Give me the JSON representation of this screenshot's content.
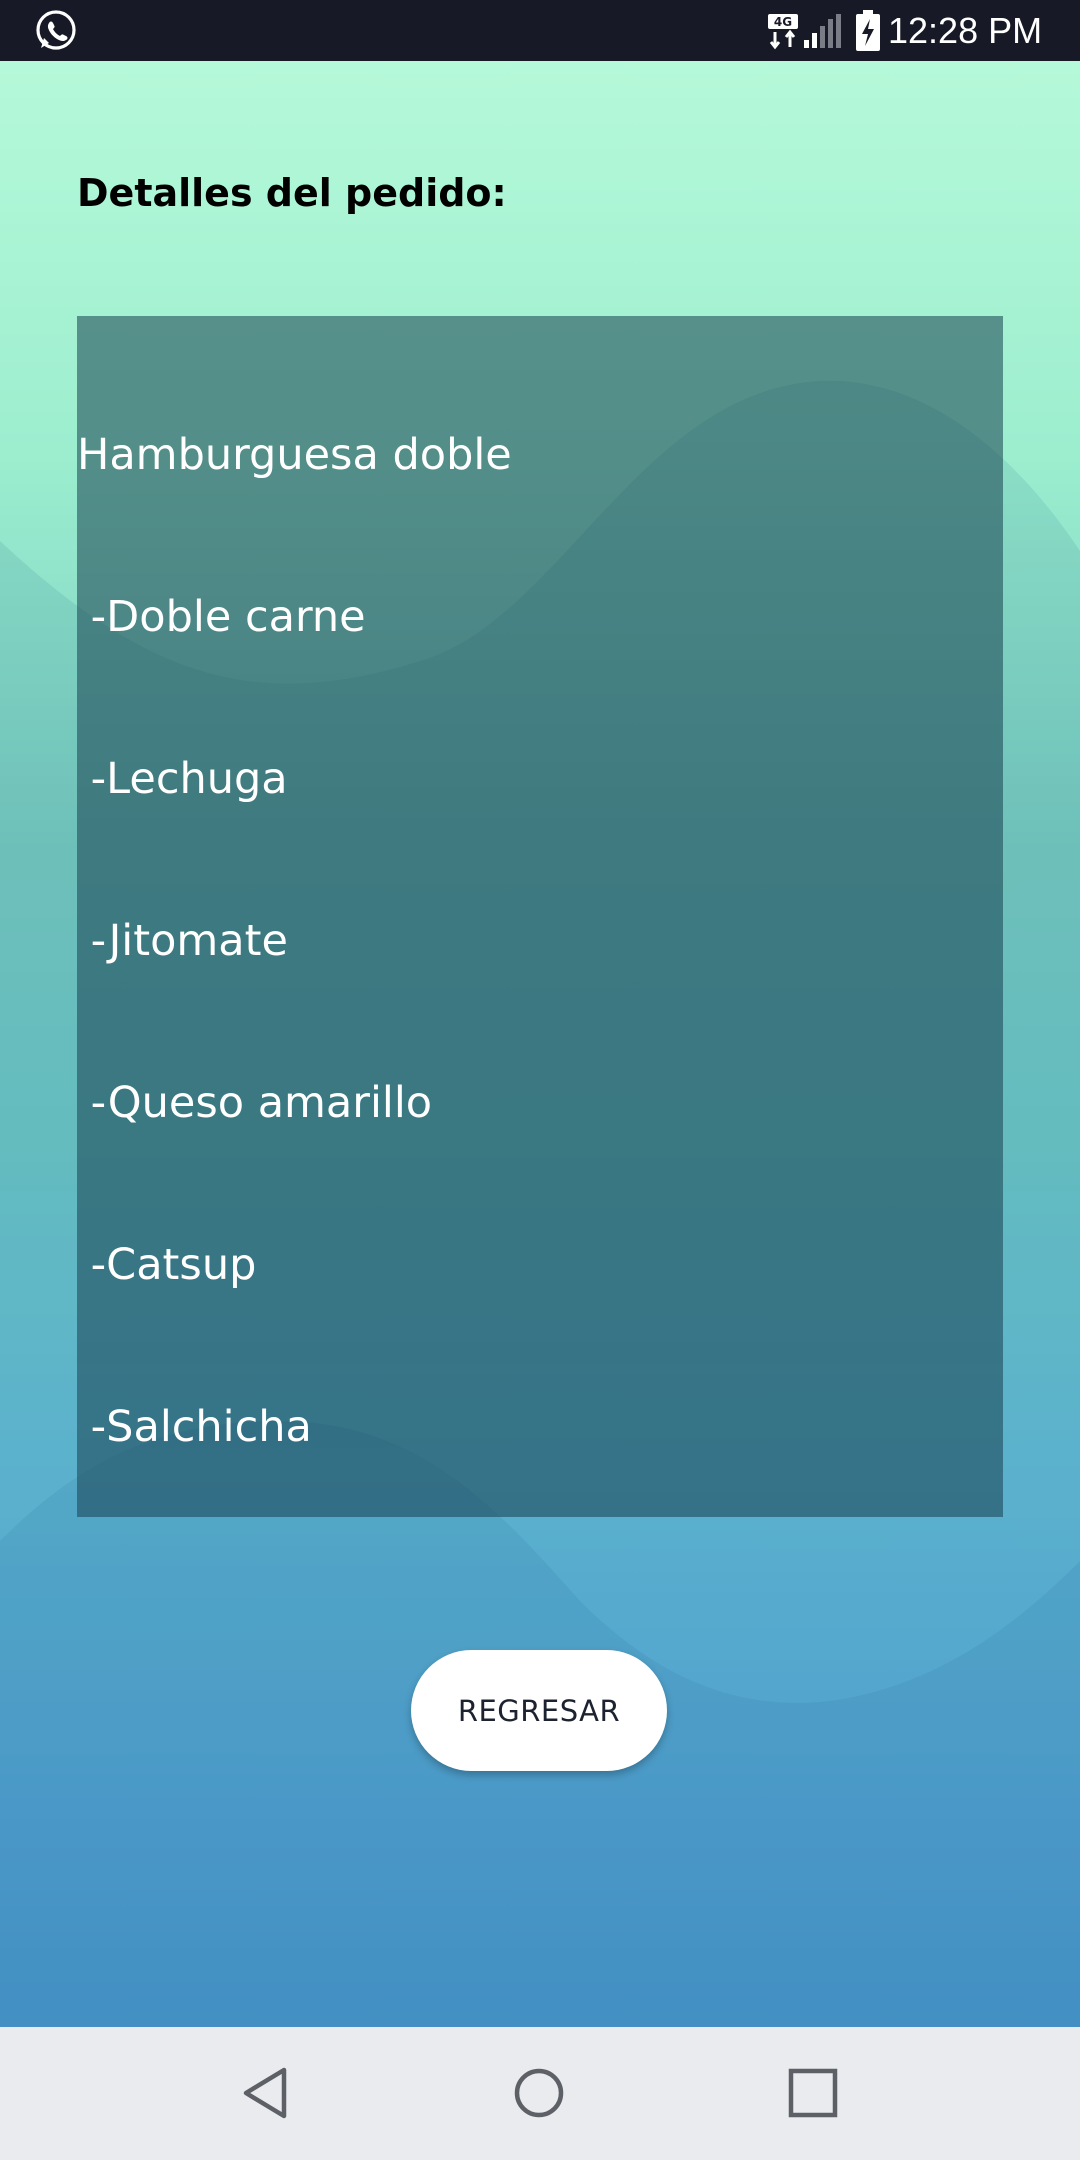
{
  "status_bar": {
    "time": "12:28 PM",
    "network_type": "4G",
    "icons": [
      "whatsapp-icon",
      "network-4g-icon",
      "signal-icon",
      "battery-charging-icon"
    ]
  },
  "screen": {
    "title": "Detalles del pedido:",
    "order_details": {
      "lines": [
        "Hamburguesa doble",
        " -Doble carne",
        " -Lechuga",
        " -Jitomate",
        " -Queso amarillo",
        " -Catsup",
        " -Salchicha"
      ]
    },
    "back_button_label": "REGRESAR"
  },
  "navigation_bar": {
    "buttons": [
      "back-triangle-icon",
      "home-circle-icon",
      "recents-square-icon"
    ]
  },
  "colors": {
    "status_bar_bg": "#171a26",
    "gradient_top": "#b5f9d9",
    "gradient_bottom": "#4c98d4",
    "panel_overlay": "#184050",
    "button_bg": "#ffffff",
    "nav_bar_bg": "#e9ebee"
  }
}
